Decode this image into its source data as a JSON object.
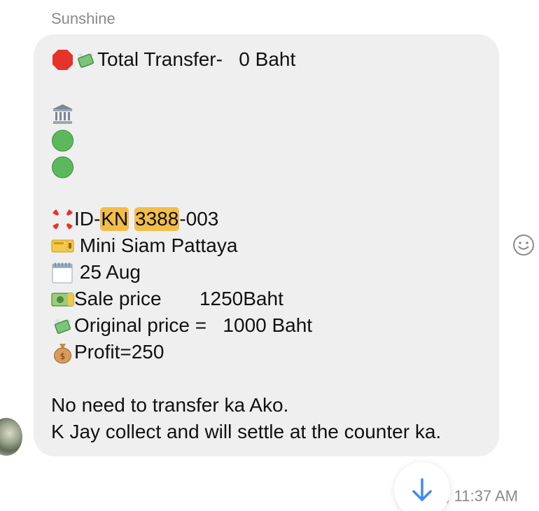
{
  "sender": {
    "name": "Sunshine"
  },
  "message": {
    "line1": {
      "icon1": "stop-sign-icon",
      "icon2": "money-with-wings-icon",
      "text": "Total Transfer-   0 Baht"
    },
    "bank_icon": "bank-icon",
    "status_icons": [
      "green-circle-icon",
      "green-circle-icon"
    ],
    "id_line": {
      "icon": "anger-symbol-icon",
      "prefix": "ID-",
      "hl1": "KN",
      "hl2": "3388",
      "suffix": "-003"
    },
    "place": {
      "icon": "ticket-icon",
      "text": " Mini Siam Pattaya"
    },
    "date": {
      "icon": "calendar-icon",
      "text": " 25 Aug"
    },
    "sale": {
      "icon": "banknote-icon",
      "text": "Sale price       1250Baht"
    },
    "original": {
      "icon": "money-with-wings-icon",
      "text": "Original price =   1000 Baht"
    },
    "profit": {
      "icon": "money-bag-icon",
      "text": "Profit=250"
    },
    "note1": "No need to transfer ka Ako.",
    "note2": "K Jay collect and will settle at the counter ka."
  },
  "timestamp": "Aug 25, 11:37 AM",
  "colors": {
    "bubble": "#efefef",
    "highlight": "#f2bd4a",
    "accent": "#3b8bf5",
    "muted": "#8a8a8e"
  }
}
